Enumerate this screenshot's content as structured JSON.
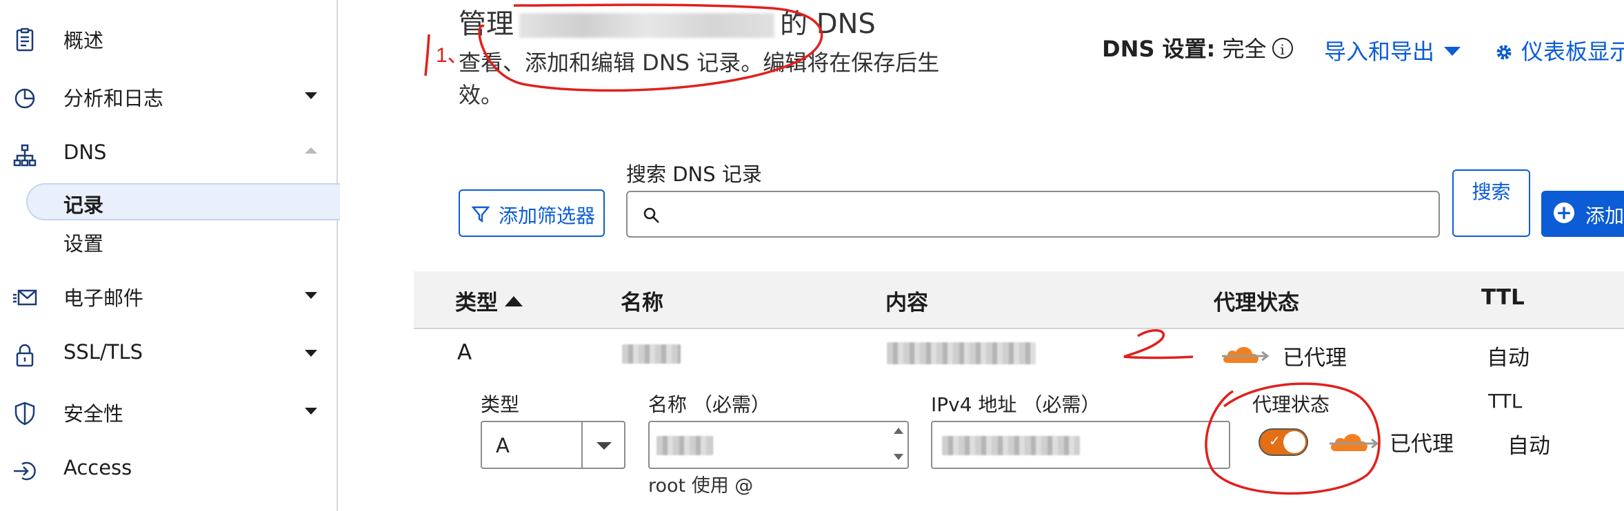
{
  "sidebar": {
    "items": [
      {
        "label": "概述",
        "icon": "document-icon"
      },
      {
        "label": "分析和日志",
        "icon": "pie-chart-icon"
      },
      {
        "label": "DNS",
        "icon": "sitemap-icon"
      },
      {
        "label": "电子邮件",
        "icon": "mail-icon"
      },
      {
        "label": "SSL/TLS",
        "icon": "lock-icon"
      },
      {
        "label": "安全性",
        "icon": "shield-icon"
      },
      {
        "label": "Access",
        "icon": "access-icon"
      }
    ],
    "dns_sub": [
      {
        "label": "记录",
        "active": true
      },
      {
        "label": "设置",
        "active": false
      }
    ]
  },
  "header": {
    "title_prefix": "管理",
    "title_suffix": "的 DNS",
    "description": "查看、添加和编辑 DNS 记录。编辑将在保存后生效。",
    "dns_setting_label": "DNS 设置:",
    "dns_setting_value": "完全",
    "import_export": "导入和导出",
    "dashboard_link": "仪表板显示"
  },
  "toolbar": {
    "filter_button": "添加筛选器",
    "search_label": "搜索 DNS 记录",
    "search_placeholder": "",
    "search_button": "搜索",
    "add_button": "添加"
  },
  "table": {
    "columns": [
      "类型",
      "名称",
      "内容",
      "代理状态",
      "TTL"
    ],
    "rows": [
      {
        "type": "A",
        "name": "",
        "content": "",
        "proxy": "已代理",
        "ttl": "自动"
      }
    ]
  },
  "edit_form": {
    "type_label": "类型",
    "type_value": "A",
    "name_label": "名称 （必需）",
    "name_hint": "root 使用 @",
    "ipv4_label": "IPv4 地址 （必需）",
    "proxy_label": "代理状态",
    "proxy_value": "已代理",
    "proxy_enabled": true,
    "ttl_label": "TTL",
    "ttl_value": "自动"
  },
  "annotations": {
    "mark_1": "1、",
    "mark_2": "2"
  },
  "colors": {
    "accent": "#0b5cd5",
    "cloud_orange": "#f38020",
    "annotation_red": "#e0201c",
    "header_bg": "#f2f2f2"
  }
}
